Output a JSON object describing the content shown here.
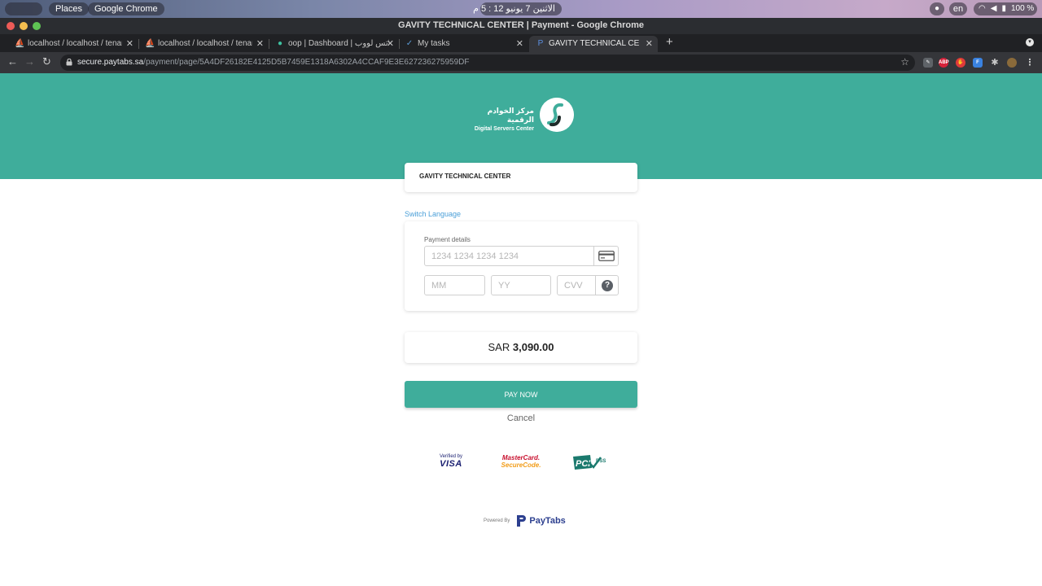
{
  "system_bar": {
    "apple_icon": "apple-icon",
    "places": "Places",
    "app": "Google Chrome",
    "clock": "الاثنين 7 يونيو  12 : 5 م",
    "language": "en",
    "battery": "100 %"
  },
  "window": {
    "title": "GAVITY TECHNICAL CENTER | Payment - Google Chrome"
  },
  "tabs": [
    {
      "label": "localhost / localhost / tenant_",
      "icon": "phpmyadmin-icon"
    },
    {
      "label": "localhost / localhost / tenant_",
      "icon": "phpmyadmin-icon"
    },
    {
      "label": "oop | Dashboard | واتس لووب",
      "icon": "chat-icon"
    },
    {
      "label": "My tasks",
      "icon": "tasks-icon"
    },
    {
      "label": "GAVITY TECHNICAL CENTER | ",
      "icon": "paytabs-icon"
    }
  ],
  "toolbar": {
    "url_host": "secure.paytabs.sa",
    "url_path": "/payment/page/5A4DF26182E4125D5B7459E1318A6302A4CCAF9E3E627236275959DF"
  },
  "brand": {
    "logo_ar": "مركز الخوادم الرقمية",
    "logo_en": "Digital Servers Center",
    "accent": "#3fad9b"
  },
  "merchant": {
    "name": "GAVITY TECHNICAL CENTER"
  },
  "switch_language": "Switch Language",
  "payment": {
    "label": "Payment details",
    "card_placeholder": "1234 1234 1234 1234",
    "mm_placeholder": "MM",
    "yy_placeholder": "YY",
    "cvv_placeholder": "CVV",
    "help": "?"
  },
  "amount": {
    "currency": "SAR",
    "value": "3,090.00"
  },
  "pay_now": "PAY NOW",
  "cancel": "Cancel",
  "badges": {
    "visa_top": "Verified by",
    "visa_main": "VISA",
    "mc_top": "MasterCard.",
    "mc_main": "SecureCode.",
    "pci": "PCI",
    "pci_dss": "DSS"
  },
  "footer": {
    "powered_by": "Powered By",
    "provider": "PayTabs"
  }
}
